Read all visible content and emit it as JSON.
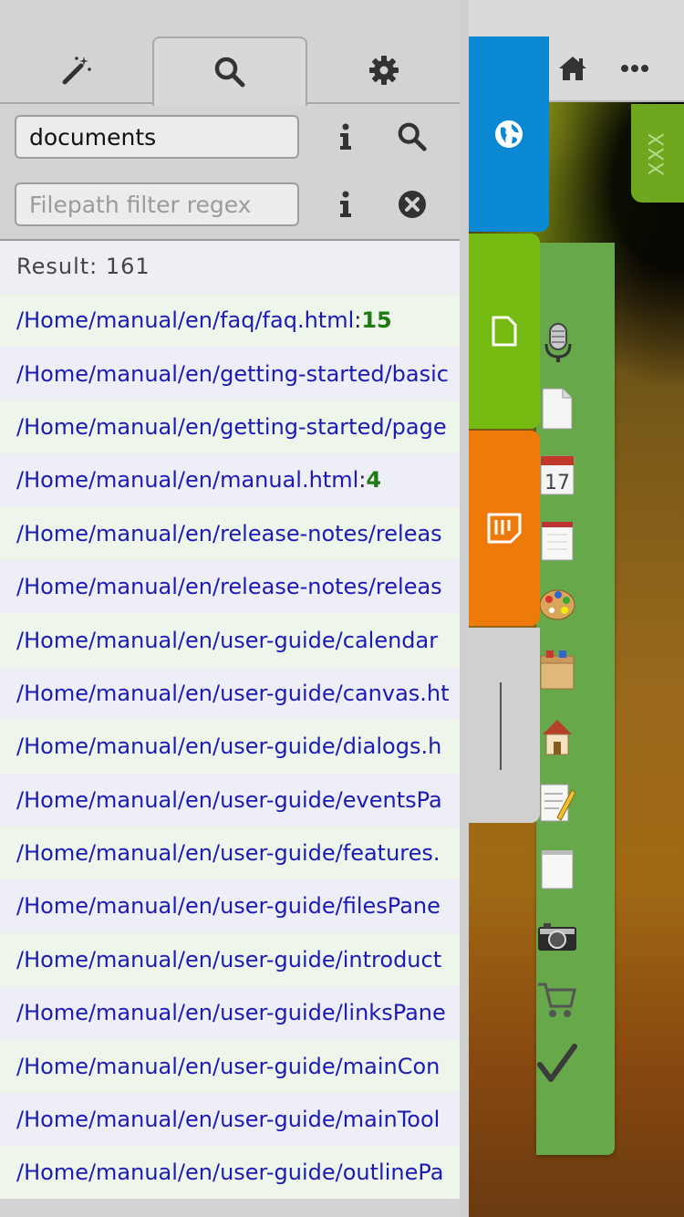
{
  "search": {
    "query_value": "documents",
    "filter_placeholder": "Filepath filter regex",
    "result_label": "Result: 161"
  },
  "results": [
    {
      "path": "/Home/manual/en/faq/faq.html",
      "sep": " : ",
      "count": "15"
    },
    {
      "path": "/Home/manual/en/getting-started/basic",
      "sep": "",
      "count": ""
    },
    {
      "path": "/Home/manual/en/getting-started/page",
      "sep": "",
      "count": ""
    },
    {
      "path": "/Home/manual/en/manual.html",
      "sep": " : ",
      "count": "4"
    },
    {
      "path": "/Home/manual/en/release-notes/releas",
      "sep": "",
      "count": ""
    },
    {
      "path": "/Home/manual/en/release-notes/releas",
      "sep": "",
      "count": ""
    },
    {
      "path": "/Home/manual/en/user-guide/calendar",
      "sep": "",
      "count": ""
    },
    {
      "path": "/Home/manual/en/user-guide/canvas.ht",
      "sep": "",
      "count": ""
    },
    {
      "path": "/Home/manual/en/user-guide/dialogs.h",
      "sep": "",
      "count": ""
    },
    {
      "path": "/Home/manual/en/user-guide/eventsPa",
      "sep": "",
      "count": ""
    },
    {
      "path": "/Home/manual/en/user-guide/features.",
      "sep": "",
      "count": ""
    },
    {
      "path": "/Home/manual/en/user-guide/filesPane",
      "sep": "",
      "count": ""
    },
    {
      "path": "/Home/manual/en/user-guide/introduct",
      "sep": "",
      "count": ""
    },
    {
      "path": "/Home/manual/en/user-guide/linksPane",
      "sep": "",
      "count": ""
    },
    {
      "path": "/Home/manual/en/user-guide/mainCon",
      "sep": "",
      "count": ""
    },
    {
      "path": "/Home/manual/en/user-guide/mainTool",
      "sep": "",
      "count": ""
    },
    {
      "path": "/Home/manual/en/user-guide/outlinePa",
      "sep": "",
      "count": ""
    }
  ],
  "side_tab_label": "XXX",
  "colors": {
    "globe_tab": "#0a88d4",
    "note_tab": "#76bb12",
    "sticky_tab": "#ee7a0a",
    "icon_panel": "#66a84a",
    "path_link": "#1a1ab4",
    "count_text": "#1f7a12"
  },
  "icons": {
    "tabs": [
      "magic-wand-icon",
      "search-icon",
      "gear-icon"
    ],
    "topbar": [
      "home-icon",
      "more-icon"
    ],
    "vertical_tabs": [
      "globe-icon",
      "note-icon",
      "sticky-note-icon"
    ],
    "panel": [
      "microphone-icon",
      "document-icon",
      "calendar-icon",
      "notepad-icon",
      "palette-icon",
      "box-icon",
      "house-icon",
      "pencil-note-icon",
      "blank-note-icon",
      "camera-icon",
      "cart-icon",
      "checkmark-icon"
    ]
  }
}
